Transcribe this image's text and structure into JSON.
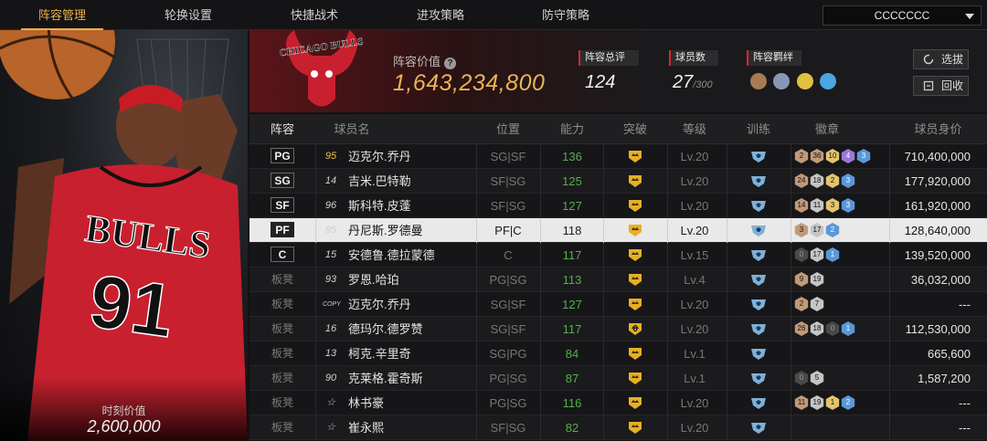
{
  "nav": {
    "tabs": [
      "阵容管理",
      "轮换设置",
      "快捷战术",
      "进攻策略",
      "防守策略"
    ],
    "active_tab": "阵容管理",
    "account_name": "CCCCCCC"
  },
  "hero": {
    "jersey_team": "BULLS",
    "jersey_number": "91",
    "value_label": "时刻价值",
    "value": "2,600,000"
  },
  "summary": {
    "logo_text": "CHICAGO BULLS",
    "lineup_value_label": "阵容价值",
    "lineup_value": "1,643,234,800",
    "overall_label": "阵容总评",
    "overall_value": "124",
    "players_label": "球员数",
    "players_value": "27",
    "players_max": "/300",
    "bond_label": "阵容羁绊",
    "select_button": "选拔",
    "recycle_button": "回收"
  },
  "table": {
    "headers": {
      "lineup": "阵容",
      "name": "球员名",
      "position": "位置",
      "ability": "能力",
      "breakthrough": "突破",
      "level": "等级",
      "training": "训练",
      "badges": "徽章",
      "worth": "球员身价"
    },
    "rows": [
      {
        "slot": "PG",
        "num": "95",
        "name": "迈克尔.乔丹",
        "pos": "SG|SF",
        "ability": "136",
        "brk": "",
        "level": "Lv.20",
        "badges": [
          [
            "b",
            "2"
          ],
          [
            "b",
            "36"
          ],
          [
            "g",
            "10"
          ],
          [
            "p",
            "4"
          ],
          [
            "bl",
            "3"
          ]
        ],
        "worth": "710,400,000"
      },
      {
        "slot": "SG",
        "num": "14",
        "name": "吉米.巴特勒",
        "pos": "SF|SG",
        "ability": "125",
        "brk": "",
        "level": "Lv.20",
        "badges": [
          [
            "b",
            "24"
          ],
          [
            "s",
            "18"
          ],
          [
            "g",
            "2"
          ],
          [
            "bl",
            "3"
          ]
        ],
        "worth": "177,920,000"
      },
      {
        "slot": "SF",
        "num": "96",
        "name": "斯科特.皮蓬",
        "pos": "SF|SG",
        "ability": "127",
        "brk": "",
        "level": "Lv.20",
        "badges": [
          [
            "b",
            "14"
          ],
          [
            "s",
            "11"
          ],
          [
            "g",
            "3"
          ],
          [
            "bl",
            "3"
          ]
        ],
        "worth": "161,920,000"
      },
      {
        "slot": "PF",
        "num": "95",
        "name": "丹尼斯.罗德曼",
        "pos": "PF|C",
        "ability": "118",
        "brk": "",
        "level": "Lv.20",
        "badges": [
          [
            "b",
            "3"
          ],
          [
            "s",
            "17"
          ],
          [
            "bl",
            "2"
          ]
        ],
        "worth": "128,640,000"
      },
      {
        "slot": "C",
        "num": "15",
        "name": "安德鲁.德拉蒙德",
        "pos": "C",
        "ability": "117",
        "brk": "",
        "level": "Lv.15",
        "badges": [
          [
            "d",
            "0"
          ],
          [
            "s",
            "17"
          ],
          [
            "bl",
            "1"
          ]
        ],
        "worth": "139,520,000"
      },
      {
        "slot": "板凳",
        "num": "93",
        "name": "罗恩.哈珀",
        "pos": "PG|SG",
        "ability": "113",
        "brk": "",
        "level": "Lv.4",
        "badges": [
          [
            "b",
            "9"
          ],
          [
            "s",
            "19"
          ]
        ],
        "worth": "36,032,000"
      },
      {
        "slot": "板凳",
        "num": "COPY",
        "name": "迈克尔.乔丹",
        "pos": "SG|SF",
        "ability": "127",
        "brk": "",
        "level": "Lv.20",
        "badges": [
          [
            "b",
            "2"
          ],
          [
            "s",
            "7"
          ]
        ],
        "worth": "---"
      },
      {
        "slot": "板凳",
        "num": "16",
        "name": "德玛尔.德罗赞",
        "pos": "SG|SF",
        "ability": "117",
        "brk": "6",
        "level": "Lv.20",
        "badges": [
          [
            "b",
            "26"
          ],
          [
            "s",
            "18"
          ],
          [
            "d",
            "0"
          ],
          [
            "bl",
            "1"
          ]
        ],
        "worth": "112,530,000"
      },
      {
        "slot": "板凳",
        "num": "13",
        "name": "柯克.辛里奇",
        "pos": "SG|PG",
        "ability": "84",
        "brk": "",
        "level": "Lv.1",
        "badges": [],
        "worth": "665,600"
      },
      {
        "slot": "板凳",
        "num": "90",
        "name": "克莱格.霍奇斯",
        "pos": "PG|SG",
        "ability": "87",
        "brk": "",
        "level": "Lv.1",
        "badges": [
          [
            "d",
            "0"
          ],
          [
            "s",
            "5"
          ]
        ],
        "worth": "1,587,200"
      },
      {
        "slot": "板凳",
        "num": "",
        "name": "林书豪",
        "pos": "PG|SG",
        "ability": "116",
        "brk": "",
        "level": "Lv.20",
        "badges": [
          [
            "b",
            "11"
          ],
          [
            "s",
            "19"
          ],
          [
            "g",
            "1"
          ],
          [
            "bl",
            "2"
          ]
        ],
        "worth": "---"
      },
      {
        "slot": "板凳",
        "num": "",
        "name": "崔永熙",
        "pos": "SF|SG",
        "ability": "82",
        "brk": "",
        "level": "Lv.20",
        "badges": [],
        "worth": "---"
      }
    ]
  },
  "colors": {
    "accent_gold": "#e6b24a",
    "ability_green": "#54b04a",
    "team_red": "#c8202e"
  }
}
